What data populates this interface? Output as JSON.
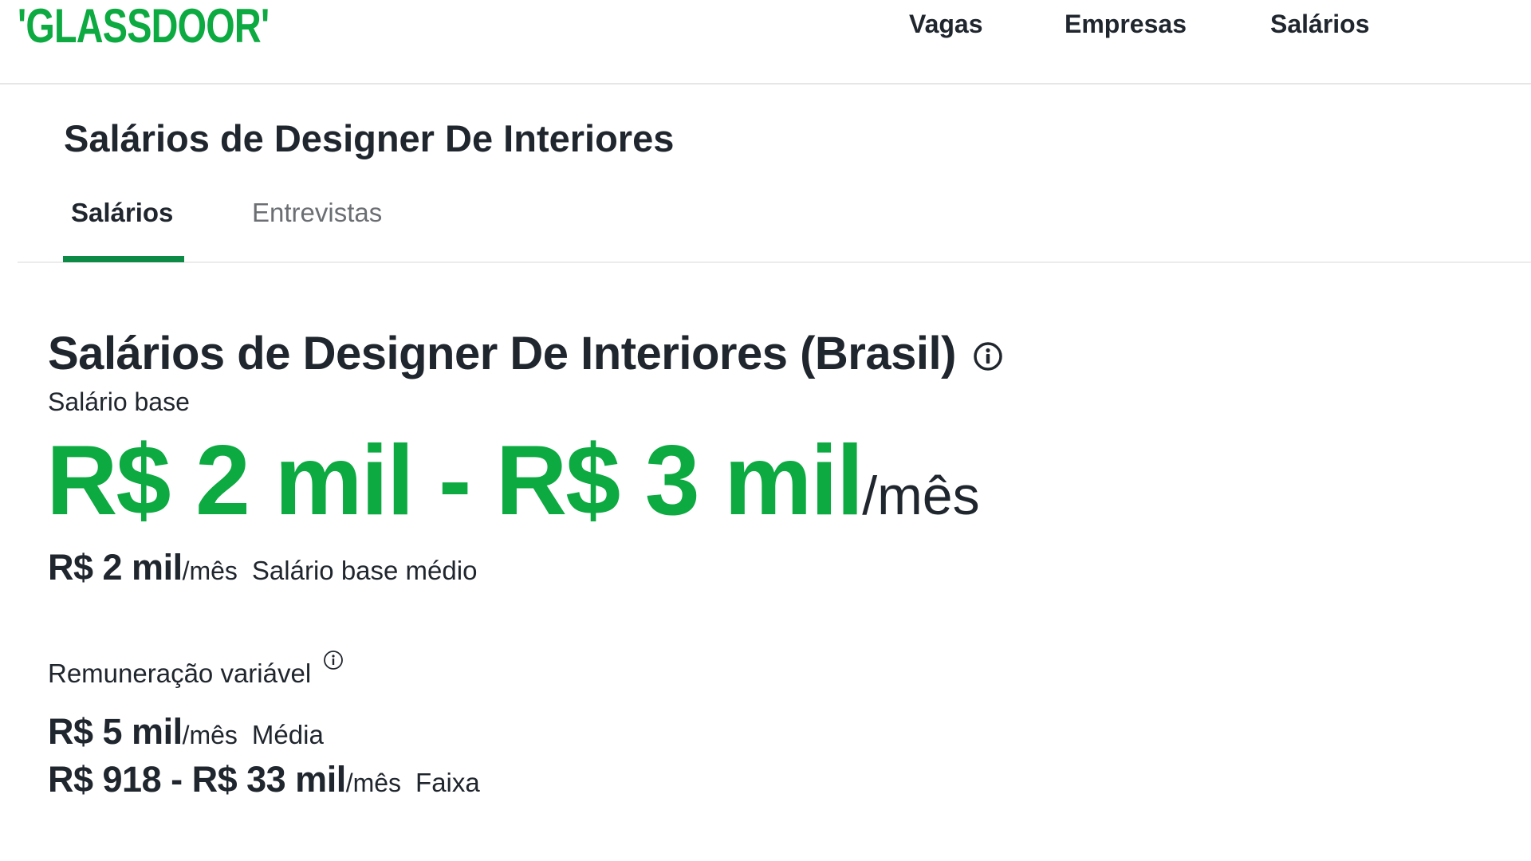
{
  "header": {
    "logo_text": "'GLASSDOOR'",
    "nav": {
      "vagas": "Vagas",
      "empresas": "Empresas",
      "salarios": "Salários"
    }
  },
  "page": {
    "title": "Salários de Designer De Interiores",
    "tabs": [
      {
        "label": "Salários",
        "active": true
      },
      {
        "label": "Entrevistas",
        "active": false
      }
    ]
  },
  "summary": {
    "heading": "Salários de Designer De Interiores (Brasil)",
    "base_label": "Salário base",
    "base_range": "R$ 2 mil - R$ 3 mil",
    "base_range_unit": "/mês",
    "avg_base_value": "R$ 2 mil",
    "avg_base_unit": "/mês",
    "avg_base_desc": "Salário base médio",
    "variable_label": "Remuneração variável",
    "variable_avg_value": "R$ 5 mil",
    "variable_avg_unit": "/mês",
    "variable_avg_desc": "Média",
    "variable_range_value": "R$ 918 - R$ 33 mil",
    "variable_range_unit": "/mês",
    "variable_range_desc": "Faixa"
  },
  "colors": {
    "brand_green": "#0caa41",
    "tab_underline": "#0d8a45",
    "text": "#20262e"
  },
  "icons": {
    "info": "info-circle-icon"
  }
}
